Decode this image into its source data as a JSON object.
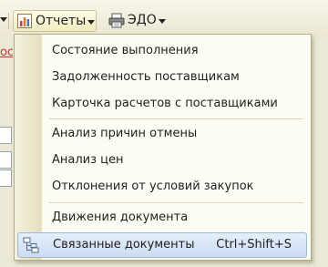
{
  "toolbar": {
    "reports_label": "Отчеты",
    "edo_label": "ЭДО"
  },
  "background": {
    "link_fragment": "ос"
  },
  "menu": {
    "items": [
      {
        "label": "Состояние выполнения"
      },
      {
        "label": "Задолженность поставщикам"
      },
      {
        "label": "Карточка расчетов с поставщиками"
      },
      {
        "label": "Анализ причин отмены"
      },
      {
        "label": "Анализ цен"
      },
      {
        "label": "Отклонения от условий закупок"
      },
      {
        "label": "Движения документа"
      },
      {
        "label": "Связанные документы",
        "shortcut": "Ctrl+Shift+S",
        "icon": "linked-documents-icon"
      }
    ]
  },
  "colors": {
    "menu_background": "#fdfdf4",
    "menu_gutter": "#e4dfbe",
    "highlight_fill": "#cbdcf2",
    "highlight_border": "#9fb9da",
    "link_red": "#c5352a",
    "button_fill": "#f1ebbf"
  }
}
